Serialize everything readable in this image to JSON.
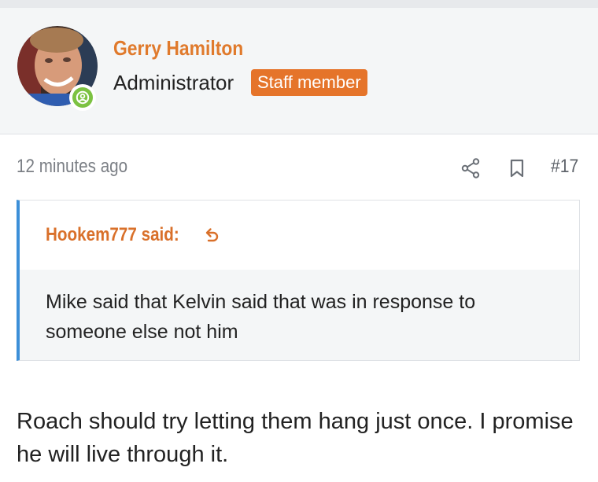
{
  "user": {
    "name": "Gerry Hamilton",
    "title": "Administrator",
    "badge": "Staff member",
    "status_icon": "online-user-icon"
  },
  "post": {
    "time": "12 minutes ago",
    "number": "#17",
    "share_icon": "share-icon",
    "bookmark_icon": "bookmark-icon",
    "quote": {
      "author_said": "Hookem777 said:",
      "arrow_icon": "jump-to-quote-icon",
      "text": "Mike said that Kelvin said that was in response to someone else not him"
    },
    "message": "Roach should try letting them hang just once. I promise he will live through it."
  },
  "colors": {
    "accent": "#e07a2c",
    "quote_border": "#3c8fd8",
    "online": "#7cc242"
  }
}
